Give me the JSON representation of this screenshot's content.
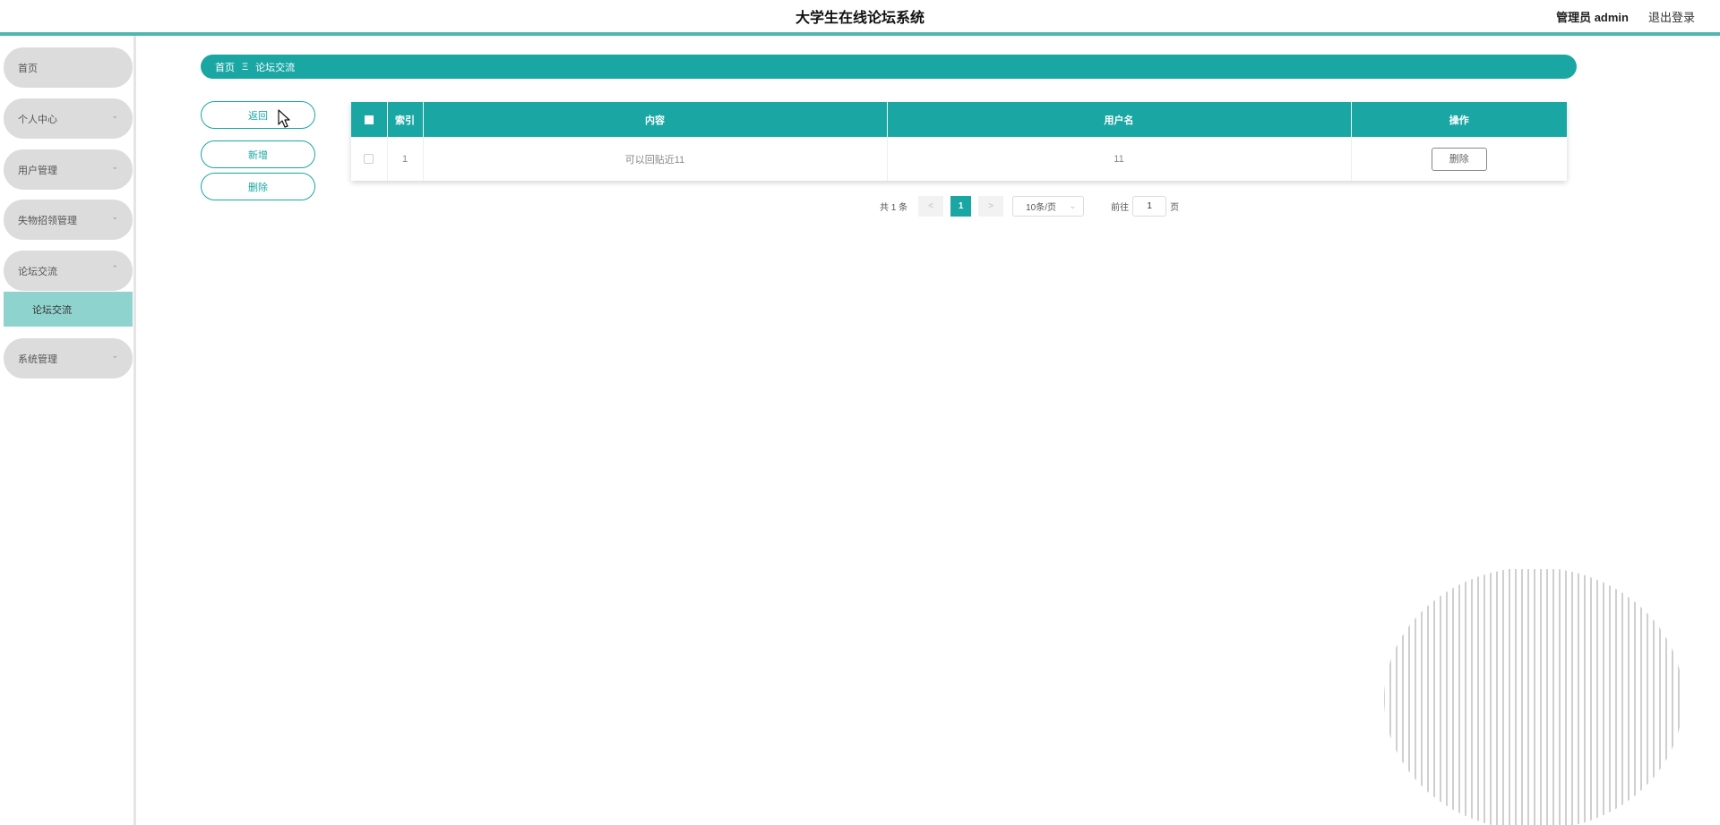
{
  "header": {
    "title": "大学生在线论坛系统",
    "admin_label": "管理员 admin",
    "logout_label": "退出登录"
  },
  "sidebar": {
    "items": [
      {
        "label": "首页"
      },
      {
        "label": "个人中心",
        "icon": "chevron-down-icon"
      },
      {
        "label": "用户管理",
        "icon": "chevron-down-icon"
      },
      {
        "label": "失物招领管理",
        "icon": "chevron-down-icon"
      },
      {
        "label": "论坛交流",
        "icon": "chevron-up-icon",
        "expanded": true
      },
      {
        "label": "系统管理",
        "icon": "chevron-down-icon"
      }
    ],
    "subitems": [
      {
        "label": "论坛交流",
        "active": true
      }
    ]
  },
  "breadcrumb": {
    "home": "首页",
    "separator": "Ξ",
    "current": "论坛交流"
  },
  "actions": {
    "back": "返回",
    "add": "新增",
    "delete": "删除"
  },
  "table": {
    "headers": {
      "index": "索引",
      "content": "内容",
      "username": "用户名",
      "operation": "操作"
    },
    "rows": [
      {
        "index": "1",
        "content": "可以回贴近11",
        "username": "11",
        "delete_label": "删除"
      }
    ]
  },
  "pagination": {
    "total": "共 1 条",
    "prev": "<",
    "current_page": "1",
    "next": ">",
    "page_size": "10条/页",
    "goto_label": "前往",
    "goto_value": "1",
    "page_unit": "页"
  },
  "colors": {
    "accent": "#1aa7a4",
    "header_border": "#4fb7b0",
    "sidebar_item_bg": "#dcdcdc",
    "sidebar_active_bg": "#8fd3cf"
  }
}
